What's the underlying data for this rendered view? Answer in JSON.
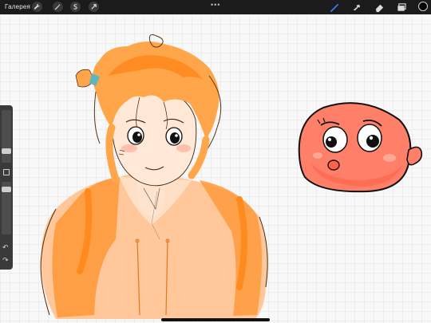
{
  "topbar": {
    "gallery_label": "Галерея",
    "actions": [
      "wrench-icon",
      "magic-wand-icon",
      "selection-s-icon",
      "transform-arrow-icon"
    ],
    "center_dots": "•••",
    "tools": [
      "brush-icon",
      "smudge-icon",
      "eraser-icon",
      "layers-icon"
    ],
    "current_color": "#000000"
  },
  "colors": {
    "accent_tool": "#3b7dff",
    "grid_line": "#dcdcdc",
    "grid_major": "#cfcfcf",
    "canvas_bg": "#f7f7f7",
    "sidebar_bg": "#3a3a3a"
  },
  "sidebar": {
    "top_slider_icon": "brush-size-slider",
    "modify_button_icon": "square-icon",
    "bottom_slider_icon": "opacity-slider",
    "undo_icon": "undo-icon",
    "redo_icon": "redo-icon"
  }
}
